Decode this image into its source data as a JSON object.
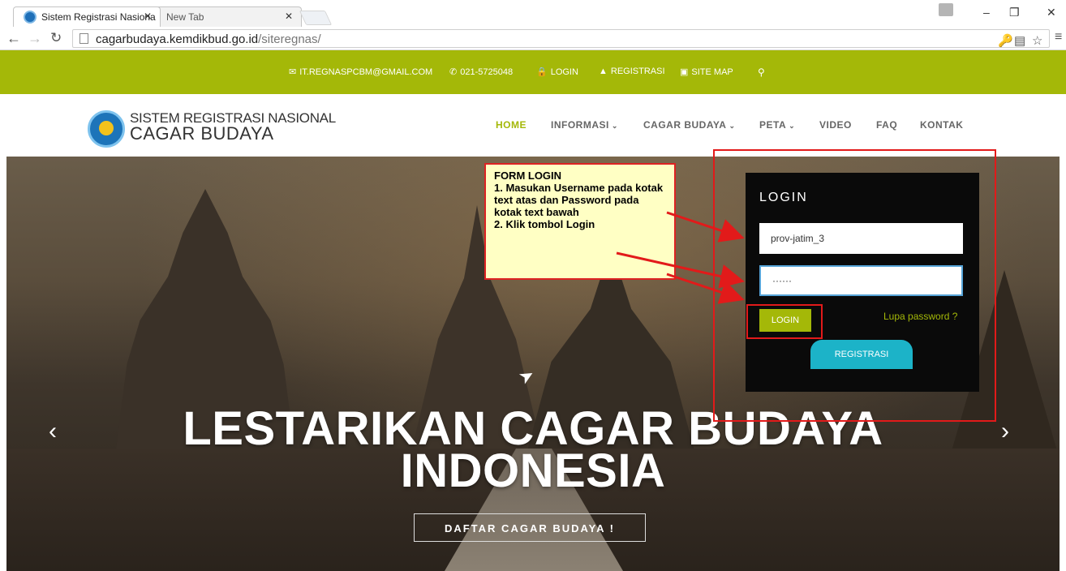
{
  "browser": {
    "tabs": [
      {
        "label": "Sistem Registrasi Nasiona",
        "close": "✕"
      },
      {
        "label": "New Tab",
        "close": "✕"
      }
    ],
    "address": {
      "domain": "cagarbudaya.kemdikbud.go.id",
      "path": "/siteregnas/"
    }
  },
  "infobar": {
    "email": "IT.REGNASPCBM@GMAIL.COM",
    "phone": "021-5725048",
    "login": "LOGIN",
    "register": "REGISTRASI",
    "sitemap": "SITE MAP"
  },
  "header": {
    "brand_line1": "SISTEM REGISTRASI NASIONAL",
    "brand_line2": "CAGAR BUDAYA",
    "menu": [
      "HOME",
      "INFORMASI",
      "CAGAR BUDAYA",
      "PETA",
      "VIDEO",
      "FAQ",
      "KONTAK"
    ]
  },
  "hero": {
    "headline_line1": "LESTARIKAN CAGAR BUDAYA",
    "headline_line2": "INDONESIA",
    "cta": "DAFTAR CAGAR BUDAYA !"
  },
  "login": {
    "title": "LOGIN",
    "username": "prov-jatim_3",
    "password": "······",
    "button": "LOGIN",
    "forgot": "Lupa password ?",
    "register": "REGISTRASI"
  },
  "annotation": {
    "text": "FORM LOGIN\n1. Masukan Username pada kotak text atas dan Password pada kotak text bawah\n2. Klik tombol Login"
  },
  "colors": {
    "accent": "#a4b808",
    "register": "#1cb3c8",
    "annotation_red": "#e21a1a"
  }
}
